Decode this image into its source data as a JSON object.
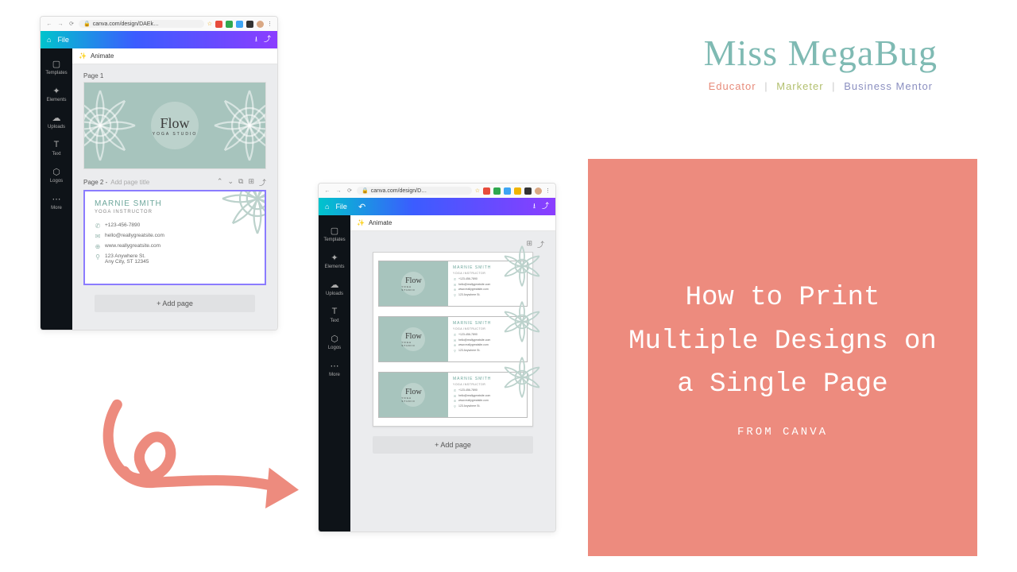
{
  "brand": {
    "name": "Miss MegaBug",
    "educator": "Educator",
    "marketer": "Marketer",
    "mentor": "Business Mentor"
  },
  "panel": {
    "title": "How to Print Multiple Designs on a Single Page",
    "sub": "FROM CANVA"
  },
  "chrome": {
    "back": "←",
    "fwd": "→",
    "reload": "⟳",
    "lock": "🔒",
    "url1": "canva.com/design/DAEk…",
    "url2": "canva.com/design/D…",
    "star": "☆",
    "ext_colors": [
      "#e74c3c",
      "#2fa84f",
      "#3da5f4",
      "#f0b400",
      "#333"
    ],
    "menu": "⋮",
    "avatar_bg": "#d9a884"
  },
  "canva": {
    "home": "⌂",
    "file": "File",
    "undo": "↶",
    "download": "⭳",
    "share": "⤴",
    "animate": "Animate",
    "sidebar": [
      {
        "ic": "▢",
        "label": "Templates"
      },
      {
        "ic": "✦",
        "label": "Elements"
      },
      {
        "ic": "☁",
        "label": "Uploads"
      },
      {
        "ic": "T",
        "label": "Text"
      },
      {
        "ic": "⬡",
        "label": "Logos"
      },
      {
        "ic": "⋯",
        "label": "More"
      }
    ],
    "page1": "Page 1",
    "page2": "Page 2 - ",
    "page2_hint": "Add page title",
    "tools": {
      "up": "⌃",
      "down": "⌄",
      "copy": "⧉",
      "dup": "⊞",
      "del": "⤴"
    },
    "add_page": "+ Add page"
  },
  "card": {
    "brand": "Flow",
    "sub": "YOGA STUDIO",
    "name": "MARNIE SMITH",
    "role": "YOGA INSTRUCTOR",
    "phone": "+123-456-7890",
    "email": "hello@reallygreatsite.com",
    "web": "www.reallygreatsite.com",
    "addr1": "123 Anywhere St.",
    "addr2": "Any City, ST 12345",
    "icons": {
      "phone": "✆",
      "mail": "✉",
      "web": "⊕",
      "pin": "⚲"
    }
  }
}
